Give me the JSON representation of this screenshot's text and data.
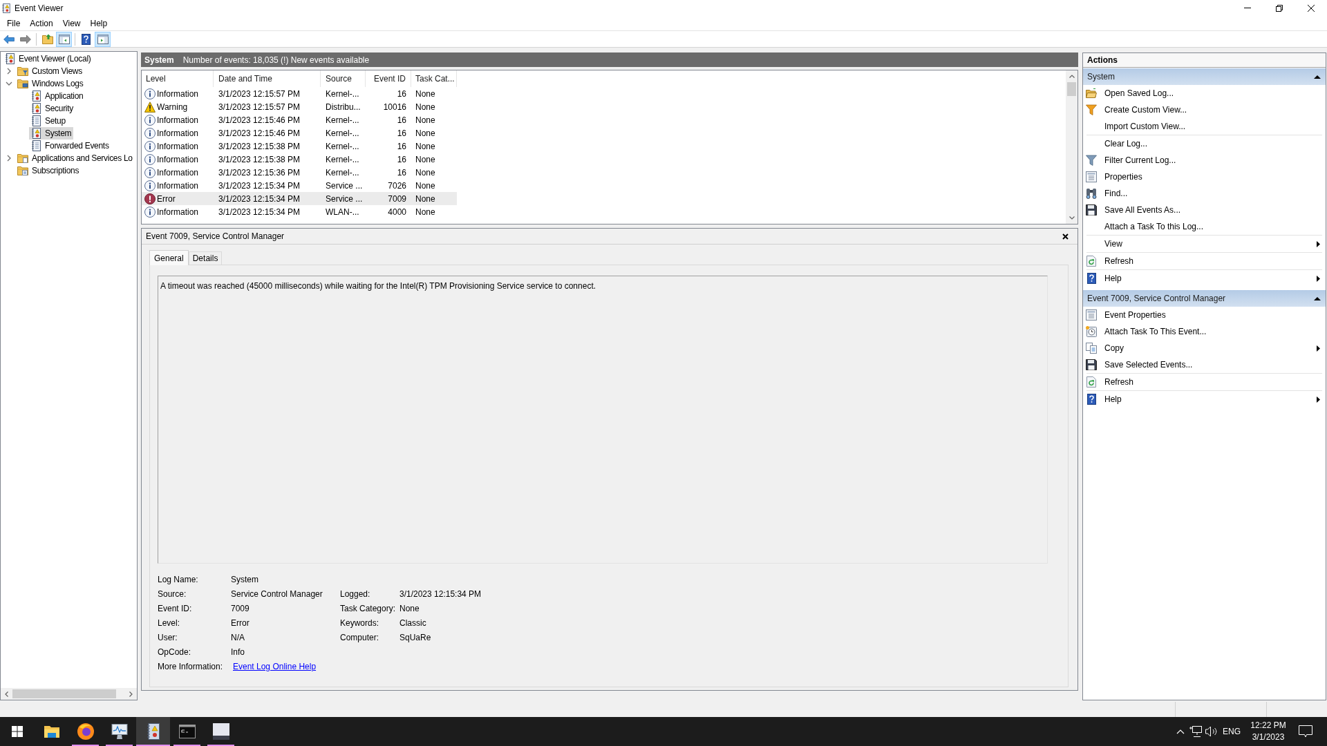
{
  "window": {
    "title": "Event Viewer"
  },
  "menu": [
    "File",
    "Action",
    "View",
    "Help"
  ],
  "toolbar": [
    {
      "kind": "back",
      "pressed": false
    },
    {
      "kind": "forward",
      "pressed": false
    },
    {
      "kind": "separator"
    },
    {
      "kind": "up",
      "pressed": false
    },
    {
      "kind": "console_tree",
      "pressed": true
    },
    {
      "kind": "separator"
    },
    {
      "kind": "help",
      "pressed": false
    },
    {
      "kind": "action_pane",
      "pressed": true
    }
  ],
  "tree": [
    {
      "label": "Event Viewer (Local)",
      "kind": "root",
      "selected": false,
      "children": [
        {
          "label": "Custom Views",
          "kind": "filter_folder",
          "expanded": false,
          "selected": false
        },
        {
          "label": "Windows Logs",
          "kind": "logs_folder",
          "expanded": true,
          "selected": false,
          "children": [
            {
              "label": "Application",
              "kind": "log",
              "selected": false
            },
            {
              "label": "Security",
              "kind": "log",
              "selected": false
            },
            {
              "label": "Setup",
              "kind": "plain_log",
              "selected": false
            },
            {
              "label": "System",
              "kind": "log",
              "selected": true
            },
            {
              "label": "Forwarded Events",
              "kind": "plain_log",
              "selected": false
            }
          ]
        },
        {
          "label": "Applications and Services Lo",
          "kind": "folder",
          "expanded": false,
          "selected": false
        },
        {
          "label": "Subscriptions",
          "kind": "subscriptions",
          "selected": false
        }
      ]
    }
  ],
  "log_header": {
    "name": "System",
    "summary": "Number of events: 18,035 (!) New events available"
  },
  "events": {
    "columns": [
      "Level",
      "Date and Time",
      "Source",
      "Event ID",
      "Task Cat..."
    ],
    "rows": [
      {
        "kind": "information",
        "level": "Information",
        "date": "3/1/2023 12:15:57 PM",
        "source": "Kernel-...",
        "event_id": "16",
        "task_category": "None",
        "selected": false
      },
      {
        "kind": "warning",
        "level": "Warning",
        "date": "3/1/2023 12:15:57 PM",
        "source": "Distribu...",
        "event_id": "10016",
        "task_category": "None",
        "selected": false
      },
      {
        "kind": "information",
        "level": "Information",
        "date": "3/1/2023 12:15:46 PM",
        "source": "Kernel-...",
        "event_id": "16",
        "task_category": "None",
        "selected": false
      },
      {
        "kind": "information",
        "level": "Information",
        "date": "3/1/2023 12:15:46 PM",
        "source": "Kernel-...",
        "event_id": "16",
        "task_category": "None",
        "selected": false
      },
      {
        "kind": "information",
        "level": "Information",
        "date": "3/1/2023 12:15:38 PM",
        "source": "Kernel-...",
        "event_id": "16",
        "task_category": "None",
        "selected": false
      },
      {
        "kind": "information",
        "level": "Information",
        "date": "3/1/2023 12:15:38 PM",
        "source": "Kernel-...",
        "event_id": "16",
        "task_category": "None",
        "selected": false
      },
      {
        "kind": "information",
        "level": "Information",
        "date": "3/1/2023 12:15:36 PM",
        "source": "Kernel-...",
        "event_id": "16",
        "task_category": "None",
        "selected": false
      },
      {
        "kind": "information",
        "level": "Information",
        "date": "3/1/2023 12:15:34 PM",
        "source": "Service ...",
        "event_id": "7026",
        "task_category": "None",
        "selected": false
      },
      {
        "kind": "error",
        "level": "Error",
        "date": "3/1/2023 12:15:34 PM",
        "source": "Service ...",
        "event_id": "7009",
        "task_category": "None",
        "selected": true
      },
      {
        "kind": "information",
        "level": "Information",
        "date": "3/1/2023 12:15:34 PM",
        "source": "WLAN-...",
        "event_id": "4000",
        "task_category": "None",
        "selected": false
      }
    ]
  },
  "event_details": {
    "title": "Event 7009, Service Control Manager",
    "tabs": [
      {
        "label": "General",
        "selected": true
      },
      {
        "label": "Details",
        "selected": false
      }
    ],
    "message": "A timeout was reached (45000 milliseconds) while waiting for the Intel(R) TPM Provisioning Service service to connect.",
    "fields": [
      [
        {
          "label": "Log Name:",
          "value": "System"
        }
      ],
      [
        {
          "label": "Source:",
          "value": "Service Control Manager"
        },
        {
          "label": "Logged:",
          "value": "3/1/2023 12:15:34 PM"
        }
      ],
      [
        {
          "label": "Event ID:",
          "value": "7009"
        },
        {
          "label": "Task Category:",
          "value": "None"
        }
      ],
      [
        {
          "label": "Level:",
          "value": "Error"
        },
        {
          "label": "Keywords:",
          "value": "Classic"
        }
      ],
      [
        {
          "label": "User:",
          "value": "N/A"
        },
        {
          "label": "Computer:",
          "value": "SqUaRe"
        }
      ],
      [
        {
          "label": "OpCode:",
          "value": "Info"
        }
      ]
    ],
    "more_information": {
      "label": "More Information:",
      "link": "Event Log Online Help"
    }
  },
  "actions": {
    "title": "Actions",
    "sections": [
      {
        "title": "System",
        "expanded": true,
        "groups": [
          [
            {
              "label": "Open Saved Log...",
              "kind": "open",
              "submenu": false
            },
            {
              "label": "Create Custom View...",
              "kind": "new_filter",
              "submenu": false
            },
            {
              "label": "Import Custom View...",
              "kind": "plain",
              "submenu": false
            }
          ],
          [
            {
              "label": "Clear Log...",
              "kind": "plain",
              "submenu": false
            },
            {
              "label": "Filter Current Log...",
              "kind": "filter",
              "submenu": false
            },
            {
              "label": "Properties",
              "kind": "properties",
              "submenu": false
            },
            {
              "label": "Find...",
              "kind": "find",
              "submenu": false
            },
            {
              "label": "Save All Events As...",
              "kind": "save",
              "submenu": false
            },
            {
              "label": "Attach a Task To this Log...",
              "kind": "plain",
              "submenu": false
            }
          ],
          [
            {
              "label": "View",
              "kind": "plain",
              "submenu": true
            }
          ],
          [
            {
              "label": "Refresh",
              "kind": "refresh",
              "submenu": false
            }
          ],
          [
            {
              "label": "Help",
              "kind": "help",
              "submenu": true
            }
          ]
        ]
      },
      {
        "title": "Event 7009, Service Control Manager",
        "expanded": true,
        "groups": [
          [
            {
              "label": "Event Properties",
              "kind": "properties",
              "submenu": false
            },
            {
              "label": "Attach Task To This Event...",
              "kind": "task",
              "submenu": false
            },
            {
              "label": "Copy",
              "kind": "copy",
              "submenu": true
            },
            {
              "label": "Save Selected Events...",
              "kind": "save",
              "submenu": false
            }
          ],
          [
            {
              "label": "Refresh",
              "kind": "refresh",
              "submenu": false
            }
          ],
          [
            {
              "label": "Help",
              "kind": "help",
              "submenu": true
            }
          ]
        ]
      }
    ]
  },
  "taskbar": {
    "apps": [
      {
        "kind": "file_explorer",
        "running": false,
        "selected": false
      },
      {
        "kind": "browser",
        "running": true,
        "selected": false
      },
      {
        "kind": "monitor",
        "running": true,
        "selected": false
      },
      {
        "kind": "event_viewer",
        "running": true,
        "selected": true
      },
      {
        "kind": "terminal",
        "running": true,
        "selected": false
      },
      {
        "kind": "picture_app",
        "running": true,
        "selected": false
      }
    ],
    "tray": {
      "language": "ENG",
      "time": "12:22 PM",
      "date": "3/1/2023"
    }
  }
}
